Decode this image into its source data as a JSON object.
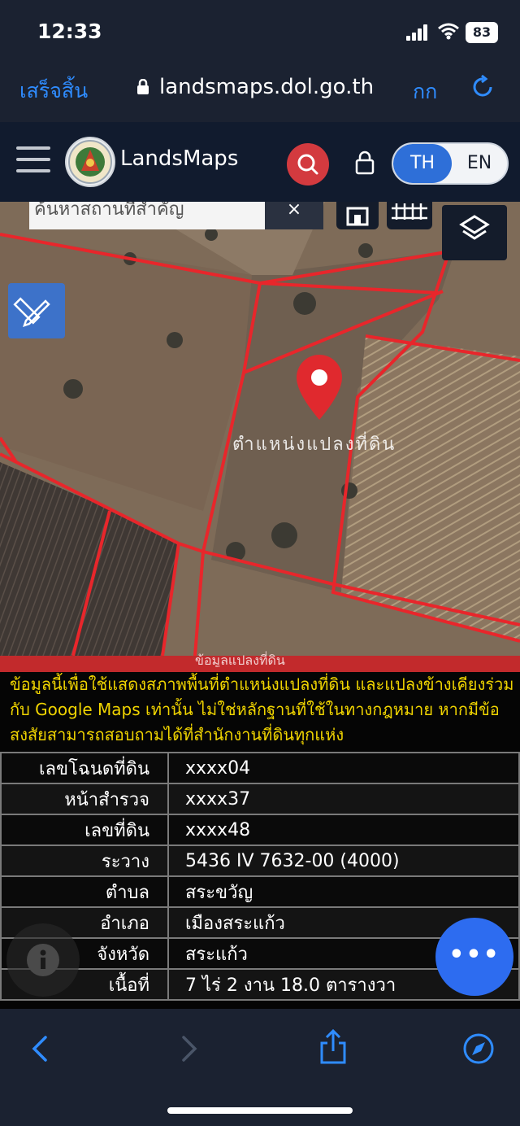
{
  "status": {
    "time": "12:33",
    "battery": "83"
  },
  "browser": {
    "done_label": "เสร็จสิ้น",
    "url": "landsmaps.dol.go.th",
    "text_size_label": "กก"
  },
  "app": {
    "brand": "LandsMaps",
    "lang_th": "TH",
    "lang_en": "EN"
  },
  "map": {
    "search_placeholder": "ค้นหาสถานที่สำคัญ",
    "clear_label": "×",
    "parcel_label": "ตำแหน่งแปลงที่ดิน"
  },
  "panel": {
    "tab_title": "ข้อมูลแปลงที่ดิน",
    "disclaimer": "ข้อมูลนี้เพื่อใช้แสดงสภาพพื้นที่ตำแหน่งแปลงที่ดิน และแปลงข้างเคียงร่วมกับ Google Maps เท่านั้น ไม่ใช่หลักฐานที่ใช้ในทางกฎหมาย หากมีข้อสงสัยสามารถสอบถามได้ที่สำนักงานที่ดินทุกแห่ง",
    "rows": [
      {
        "label": "เลขโฉนดที่ดิน",
        "value": "xxxx04"
      },
      {
        "label": "หน้าสำรวจ",
        "value": "xxxx37"
      },
      {
        "label": "เลขที่ดิน",
        "value": "xxxx48"
      },
      {
        "label": "ระวาง",
        "value": "5436 IV 7632-00 (4000)"
      },
      {
        "label": "ตำบล",
        "value": "สระขวัญ"
      },
      {
        "label": "อำเภอ",
        "value": "เมืองสระแก้ว"
      },
      {
        "label": "จังหวัด",
        "value": "สระแก้ว"
      },
      {
        "label": "เนื้อที่",
        "value": "7 ไร่ 2 งาน 18.0 ตารางวา"
      }
    ],
    "more_label": "•••"
  },
  "colors": {
    "accent": "#2f8cff",
    "parcel_line": "#e8262b",
    "warning_text": "#f0d400",
    "search_red": "#d33a3f"
  },
  "icons": [
    "search-icon",
    "lock-icon",
    "menu-icon",
    "layers-icon",
    "ruler-pencil-icon",
    "home-icon",
    "grid-icon",
    "map-pin-icon",
    "info-icon",
    "back-icon",
    "forward-icon",
    "share-icon",
    "compass-icon",
    "reload-icon"
  ]
}
